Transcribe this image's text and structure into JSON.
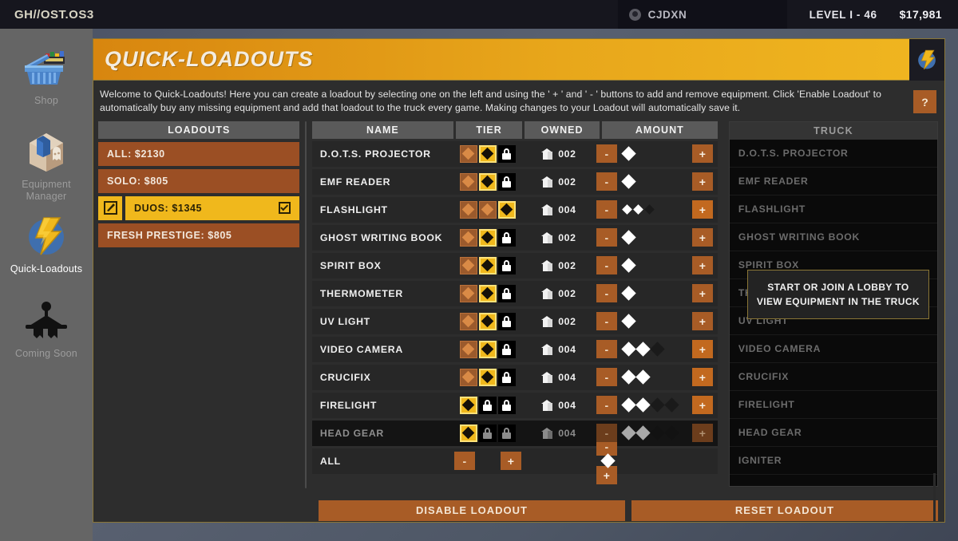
{
  "topbar": {
    "brand": "GH//OST.OS3",
    "user": "CJDXN",
    "level": "LEVEL I - 46",
    "money": "$17,981",
    "avatar_icon": "user-avatar-icon"
  },
  "sidebar": {
    "items": [
      {
        "label": "Shop",
        "icon": "shopping-basket-icon",
        "active": false
      },
      {
        "label": "Equipment\nManager",
        "label_line1": "Equipment",
        "label_line2": "Manager",
        "icon": "equipment-box-icon",
        "active": false
      },
      {
        "label": "Quick-Loadouts",
        "icon": "lightning-bolt-icon",
        "active": true
      },
      {
        "label": "Coming Soon",
        "icon": "clothes-hanger-icon",
        "active": false
      }
    ]
  },
  "panel": {
    "title": "QUICK-LOADOUTS",
    "logo_icon": "lightning-bolt-icon",
    "intro": "Welcome to Quick-Loadouts! Here you can create a loadout by selecting one on the left and using the ' + ' and ' - ' buttons to add and remove equipment. Click 'Enable Loadout' to automatically buy any missing equipment and add that loadout to the truck every game. Making changes to your Loadout will automatically save it.",
    "help_label": "?"
  },
  "loadouts": {
    "header": "LOADOUTS",
    "items": [
      {
        "label": "ALL: $2130",
        "selected": false,
        "checked": false,
        "editable": false
      },
      {
        "label": "SOLO: $805",
        "selected": false,
        "checked": false,
        "editable": false
      },
      {
        "label": "DUOS: $1345",
        "selected": true,
        "checked": true,
        "editable": true
      },
      {
        "label": "FRESH PRESTIGE: $805",
        "selected": false,
        "checked": false,
        "editable": false
      }
    ]
  },
  "table": {
    "columns": [
      "NAME",
      "TIER",
      "OWNED",
      "AMOUNT"
    ],
    "minus_label": "-",
    "plus_label": "+",
    "rows": [
      {
        "name": "D.O.T.S. PROJECTOR",
        "tiers": [
          "owned",
          "current",
          "locked"
        ],
        "owned": "002",
        "slots": [
          "half"
        ],
        "slot_size": "normal",
        "dim": false
      },
      {
        "name": "EMF READER",
        "tiers": [
          "owned",
          "current",
          "locked"
        ],
        "owned": "002",
        "slots": [
          "half"
        ],
        "slot_size": "normal",
        "dim": false
      },
      {
        "name": "FLASHLIGHT",
        "tiers": [
          "owned",
          "owned",
          "current"
        ],
        "owned": "004",
        "slots": [
          "half",
          "half",
          "empty"
        ],
        "slot_size": "small",
        "dim": false
      },
      {
        "name": "GHOST WRITING BOOK",
        "tiers": [
          "owned",
          "current",
          "locked"
        ],
        "owned": "002",
        "slots": [
          "half"
        ],
        "slot_size": "normal",
        "dim": false
      },
      {
        "name": "SPIRIT BOX",
        "tiers": [
          "owned",
          "current",
          "locked"
        ],
        "owned": "002",
        "slots": [
          "half"
        ],
        "slot_size": "normal",
        "dim": false
      },
      {
        "name": "THERMOMETER",
        "tiers": [
          "owned",
          "current",
          "locked"
        ],
        "owned": "002",
        "slots": [
          "half"
        ],
        "slot_size": "normal",
        "dim": false
      },
      {
        "name": "UV LIGHT",
        "tiers": [
          "owned",
          "current",
          "locked"
        ],
        "owned": "002",
        "slots": [
          "half"
        ],
        "slot_size": "normal",
        "dim": false
      },
      {
        "name": "VIDEO CAMERA",
        "tiers": [
          "owned",
          "current",
          "locked"
        ],
        "owned": "004",
        "slots": [
          "half",
          "half",
          "empty"
        ],
        "slot_size": "normal",
        "dim": false
      },
      {
        "name": "CRUCIFIX",
        "tiers": [
          "owned",
          "current",
          "locked"
        ],
        "owned": "004",
        "slots": [
          "half",
          "half"
        ],
        "slot_size": "normal",
        "dim": false
      },
      {
        "name": "FIRELIGHT",
        "tiers": [
          "current",
          "locked",
          "locked"
        ],
        "owned": "004",
        "slots": [
          "full",
          "full",
          "empty",
          "empty"
        ],
        "slot_size": "normal",
        "dim": false
      },
      {
        "name": "HEAD GEAR",
        "tiers": [
          "current",
          "locked",
          "locked"
        ],
        "owned": "004",
        "slots": [
          "full",
          "full",
          "empty",
          "empty"
        ],
        "slot_size": "normal",
        "dim": true
      }
    ],
    "all_row": {
      "name": "ALL",
      "slots": [
        "full"
      ]
    }
  },
  "actions": {
    "disable_loadout": "DISABLE LOADOUT",
    "reset_loadout": "RESET LOADOUT"
  },
  "truck": {
    "header": "TRUCK",
    "tooltip": "START OR JOIN A LOBBY TO VIEW EQUIPMENT IN THE TRUCK",
    "items": [
      "D.O.T.S. PROJECTOR",
      "EMF READER",
      "FLASHLIGHT",
      "GHOST WRITING BOOK",
      "SPIRIT BOX",
      "THERMOMETER",
      "UV LIGHT",
      "VIDEO CAMERA",
      "CRUCIFIX",
      "FIRELIGHT",
      "HEAD GEAR",
      "IGNITER"
    ]
  },
  "colors": {
    "accent_orange": "#a85c26",
    "accent_yellow": "#f0b81c",
    "panel_bg": "#2d2d2d",
    "sidebar_bg": "#656565",
    "topbar_bg": "#16161e",
    "border_gold": "#8a7636"
  }
}
